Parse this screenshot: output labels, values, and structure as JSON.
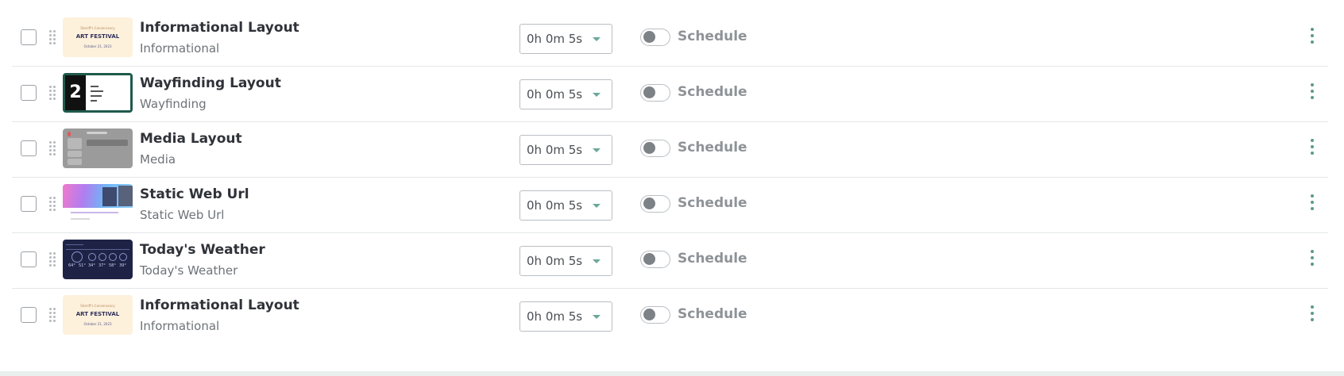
{
  "rows": [
    {
      "thumbnail": "art-festival-thumbnail",
      "thumb_text": {
        "line1": "Sheriff's Conservancy",
        "line2": "ART FESTIVAL",
        "line3": "October 21, 2023"
      },
      "title": "Informational Layout",
      "subtitle": "Informational",
      "duration": "0h 0m 5s",
      "schedule_label": "Schedule",
      "schedule_enabled": false
    },
    {
      "thumbnail": "wayfinding-thumbnail",
      "thumb_text": {
        "number": "2"
      },
      "title": "Wayfinding Layout",
      "subtitle": "Wayfinding",
      "duration": "0h 0m 5s",
      "schedule_label": "Schedule",
      "schedule_enabled": false
    },
    {
      "thumbnail": "media-thumbnail",
      "title": "Media Layout",
      "subtitle": "Media",
      "duration": "0h 0m 5s",
      "schedule_label": "Schedule",
      "schedule_enabled": false
    },
    {
      "thumbnail": "static-web-thumbnail",
      "title": "Static Web Url",
      "subtitle": "Static Web Url",
      "duration": "0h 0m 5s",
      "schedule_label": "Schedule",
      "schedule_enabled": false
    },
    {
      "thumbnail": "weather-thumbnail",
      "thumb_text": {
        "temps": [
          "64°",
          "51°",
          "34°",
          "37°",
          "58°",
          "39°"
        ]
      },
      "title": "Today's Weather",
      "subtitle": "Today's Weather",
      "duration": "0h 0m 5s",
      "schedule_label": "Schedule",
      "schedule_enabled": false
    },
    {
      "thumbnail": "art-festival-thumbnail",
      "thumb_text": {
        "line1": "Sheriff's Conservancy",
        "line2": "ART FESTIVAL",
        "line3": "October 21, 2023"
      },
      "title": "Informational Layout",
      "subtitle": "Informational",
      "duration": "0h 0m 5s",
      "schedule_label": "Schedule",
      "schedule_enabled": false
    }
  ],
  "colors": {
    "accent": "#5b9a8b",
    "wayfinding_frame": "#1f5a4c",
    "weather_bg": "#1e2346",
    "info_bg": "#fdf1dc"
  },
  "icons": {
    "drag": "drag-handle-icon",
    "dropdown": "chevron-down-icon",
    "menu": "more-vertical-icon"
  }
}
